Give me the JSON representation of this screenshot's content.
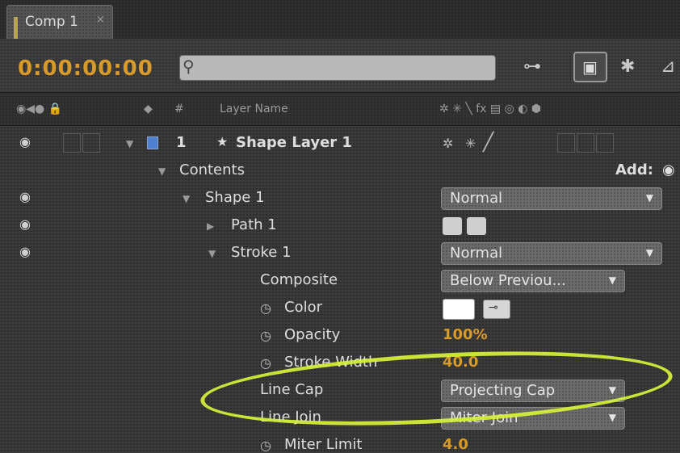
{
  "tab": {
    "label": "Comp 1",
    "close": "×"
  },
  "toolbar": {
    "timecode": "0:00:00:00",
    "search_placeholder": ""
  },
  "columns": {
    "layer_number": "#",
    "layer_name": "Layer Name"
  },
  "rows": [
    {
      "number": "1",
      "star": "★",
      "label": "Shape Layer 1"
    },
    {
      "label": "Contents",
      "add_label": "Add:"
    },
    {
      "label": "Shape 1",
      "dropdown": "Normal"
    },
    {
      "label": "Path 1"
    },
    {
      "label": "Stroke 1",
      "dropdown": "Normal"
    },
    {
      "label": "Composite",
      "dropdown": "Below Previou..."
    },
    {
      "label": "Color"
    },
    {
      "label": "Opacity",
      "value": "100%"
    },
    {
      "label": "Stroke Width",
      "value": "40.0"
    },
    {
      "label": "Line Cap",
      "dropdown": "Projecting Cap"
    },
    {
      "label": "Line Join",
      "dropdown": "Miter Join"
    },
    {
      "label": "Miter Limit",
      "value": "4.0"
    }
  ],
  "colors": {
    "timecode": "#d89a2a",
    "highlight": "#d8f23a",
    "layer_label": "#4f7fd0"
  }
}
